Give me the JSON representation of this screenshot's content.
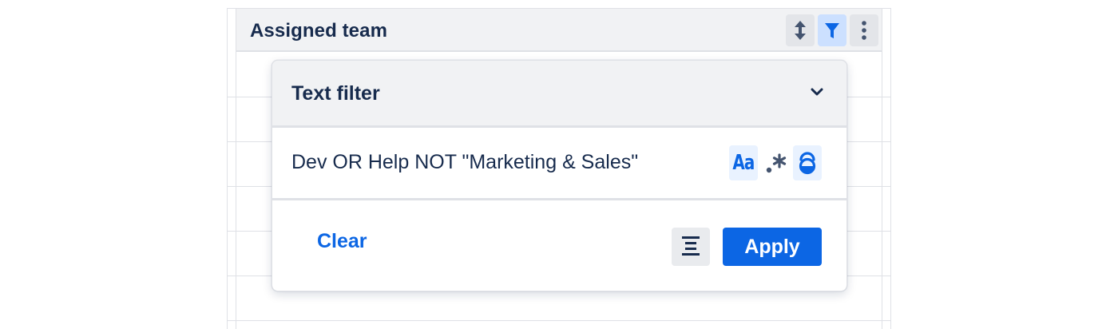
{
  "column": {
    "title": "Assigned team",
    "buttons": [
      {
        "name": "sort",
        "icon": "sort-arrows-icon"
      },
      {
        "name": "filter",
        "icon": "filter-funnel-icon",
        "active": true
      },
      {
        "name": "more",
        "icon": "more-vertical-icon"
      }
    ]
  },
  "filter_popup": {
    "title": "Text filter",
    "query": "Dev OR Help NOT \"Marketing & Sales\"",
    "options": [
      {
        "name": "match-case",
        "label": "Aa",
        "active": true
      },
      {
        "name": "regex",
        "icon": "regex-icon",
        "active": false
      },
      {
        "name": "whole-word",
        "icon": "whole-word-icon",
        "active": true
      }
    ],
    "clear_label": "Clear",
    "apply_label": "Apply"
  },
  "colors": {
    "primary": "#0C66E4",
    "text": "#172B4D",
    "header_bg": "#F1F2F4",
    "active_bg": "#CCE0FF",
    "border": "#DFE1E6"
  }
}
